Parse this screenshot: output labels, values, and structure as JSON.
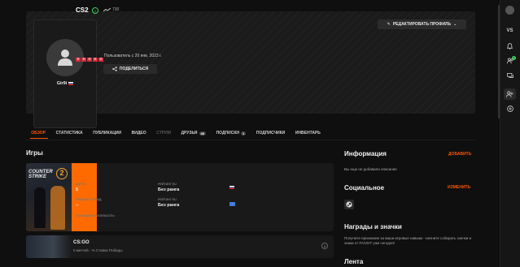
{
  "banner": {
    "edit_profile": "РЕДАКТИРОВАТЬ ПРОФИЛЬ",
    "nickname": "Gir9i",
    "member_since": "Пользователь с 20 янв. 2023 г.",
    "share": "ПОДЕЛИТЬСЯ"
  },
  "tabs": [
    {
      "label": "ОБЗОР"
    },
    {
      "label": "СТАТИСТИКА"
    },
    {
      "label": "ПУБЛИКАЦИИ"
    },
    {
      "label": "ВИДЕО"
    },
    {
      "label": "СТРИМ"
    },
    {
      "label": "ДРУЗЬЯ",
      "count": "46"
    },
    {
      "label": "ПОДПИСКИ",
      "count": "1"
    },
    {
      "label": "ПОДПИСЧИКИ"
    },
    {
      "label": "ИНВЕНТАРЬ"
    }
  ],
  "games": {
    "title": "Игры",
    "cs2": {
      "cover_text": "COUNTER STRIKE",
      "cover_num": "2",
      "name": "CS2",
      "level": "2",
      "elo": "730",
      "matches_label": "МАТЧИ",
      "matches": "5",
      "winrate_label": "ПРОЦЕНТ ПОБЕД",
      "winrate": "--",
      "recent_label": "ПОСЛЕДНИЕ РЕЗУЛЬТАТЫ",
      "recent": [
        "П",
        "П",
        "П",
        "П",
        "П"
      ],
      "rating_eu_label": "РЕЙТИНГ EU",
      "rating_eu": "Без ранга",
      "rating_country_label": "РЕЙТИНГ EU",
      "rating_country": "Без ранга"
    },
    "csgo": {
      "name": "CS:GO",
      "sub": "0 матчей · % Ставка Победы",
      "level": "1"
    }
  },
  "info": {
    "title": "Информация",
    "add": "ДОБАВИТЬ",
    "empty": "Вы еще не добавили описание",
    "social_title": "Социальное",
    "change": "ИЗМЕНИТЬ",
    "awards_title": "Награды и значки",
    "awards_text": "Получите признание за ваши игровые навыки - начните собирать значки и знаки от FACEIT уже сегодня!",
    "feed_title": "Лента"
  },
  "rail": {
    "vs": "VS",
    "badge": "1"
  }
}
